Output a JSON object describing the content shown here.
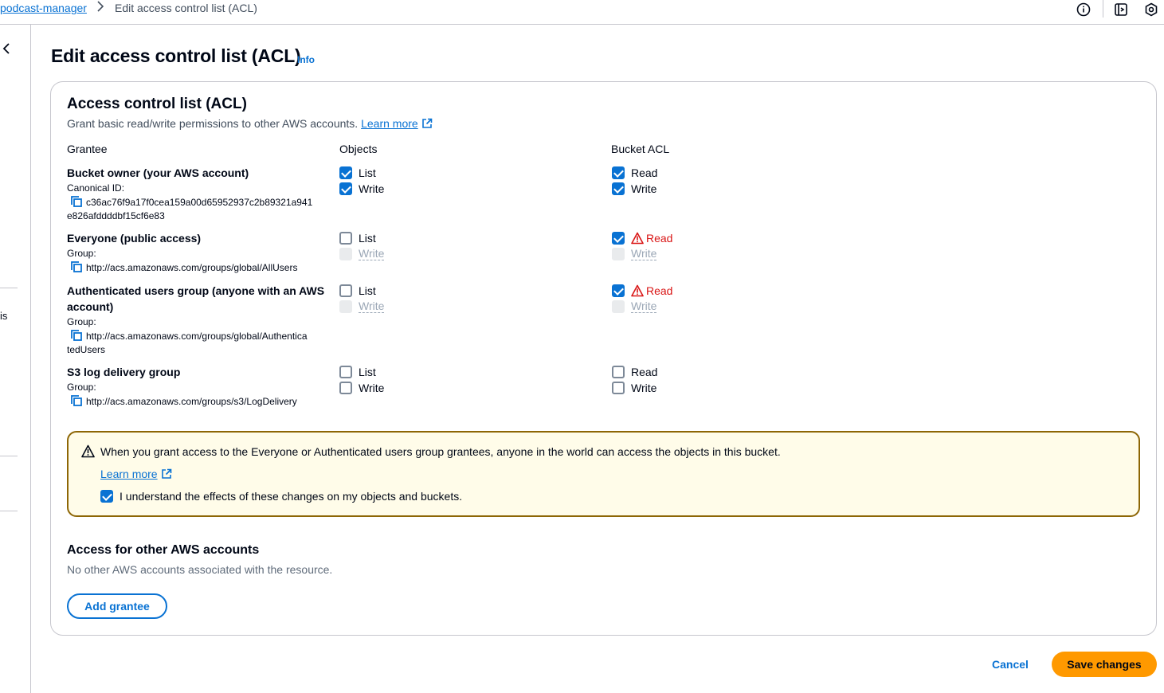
{
  "breadcrumb": {
    "parent": "podcast-manager",
    "separator": ">",
    "current": "Edit access control list (ACL)"
  },
  "leftrail": {
    "partial_text": "is"
  },
  "header": {
    "title": "Edit access control list (ACL)",
    "info": "Info"
  },
  "acl": {
    "title": "Access control list (ACL)",
    "description": "Grant basic read/write permissions to other AWS accounts.",
    "learn_more": "Learn more",
    "columns": {
      "grantee": "Grantee",
      "objects": "Objects",
      "bucket_acl": "Bucket ACL"
    },
    "grantees": [
      {
        "name": "Bucket owner (your AWS account)",
        "id_label": "Canonical ID:",
        "id_line1": "c36ac76f9a17f0cea159a00d65952937c2b89321a941",
        "id_line2": "e826afddddbf15cf6e83",
        "objects": {
          "list": "List",
          "write": "Write",
          "list_checked": true,
          "write_checked": true
        },
        "bucket": {
          "read": "Read",
          "write": "Write",
          "read_checked": true,
          "write_checked": true
        }
      },
      {
        "name": "Everyone (public access)",
        "id_label": "Group:",
        "id_line1": "http://acs.amazonaws.com/groups/global/AllUsers",
        "objects": {
          "list": "List",
          "write": "Write",
          "list_checked": false,
          "write_disabled": true
        },
        "bucket": {
          "read": "Read",
          "write": "Write",
          "read_checked": true,
          "read_warning": true,
          "write_disabled": true
        }
      },
      {
        "name_line1": "Authenticated users group (anyone with an AWS",
        "name_line2": "account)",
        "id_label": "Group:",
        "id_line1": "http://acs.amazonaws.com/groups/global/Authentica",
        "id_line2": "tedUsers",
        "objects": {
          "list": "List",
          "write": "Write",
          "list_checked": false,
          "write_disabled": true
        },
        "bucket": {
          "read": "Read",
          "write": "Write",
          "read_checked": true,
          "read_warning": true,
          "write_disabled": true
        }
      },
      {
        "name": "S3 log delivery group",
        "id_label": "Group:",
        "id_line1": "http://acs.amazonaws.com/groups/s3/LogDelivery",
        "objects": {
          "list": "List",
          "write": "Write",
          "list_checked": false,
          "write_checked": false
        },
        "bucket": {
          "read": "Read",
          "write": "Write",
          "read_checked": false,
          "write_checked": false
        }
      }
    ]
  },
  "warning": {
    "text": "When you grant access to the Everyone or Authenticated users group grantees, anyone in the world can access the objects in this bucket.",
    "learn_more": "Learn more",
    "ack_label": "I understand the effects of these changes on my objects and buckets.",
    "ack_checked": true
  },
  "other_accounts": {
    "title": "Access for other AWS accounts",
    "description": "No other AWS accounts associated with the resource.",
    "add_button": "Add grantee"
  },
  "footer": {
    "cancel": "Cancel",
    "save": "Save changes"
  },
  "colors": {
    "link": "#0972d3",
    "primary": "#ff9900",
    "warning_border": "#8d6605",
    "warning_bg": "#fffce9",
    "error": "#d91515"
  },
  "icons": [
    "info-circle-icon",
    "notifications-icon",
    "settings-hex-icon",
    "chevron-left-icon",
    "external-link-icon",
    "copy-icon",
    "warning-icon"
  ]
}
